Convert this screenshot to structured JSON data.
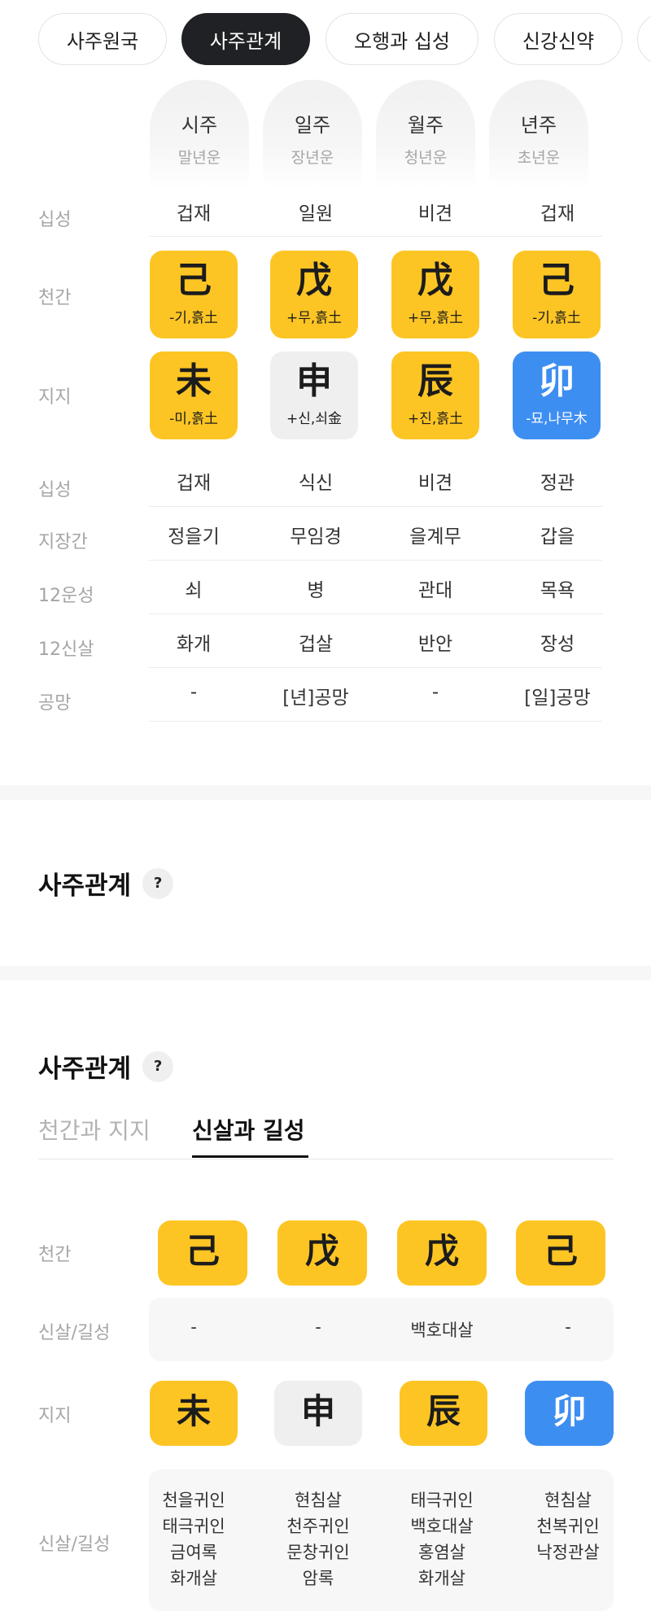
{
  "tabs": [
    {
      "label": "사주원국",
      "active": false
    },
    {
      "label": "사주관계",
      "active": true
    },
    {
      "label": "오행과 십성",
      "active": false
    },
    {
      "label": "신강신약",
      "active": false
    }
  ],
  "pillars": {
    "columns": [
      {
        "title": "시주",
        "subtitle": "말년운"
      },
      {
        "title": "일주",
        "subtitle": "장년운"
      },
      {
        "title": "월주",
        "subtitle": "청년운"
      },
      {
        "title": "년주",
        "subtitle": "초년운"
      }
    ],
    "labels": {
      "sipseong_top": "십성",
      "cheongan": "천간",
      "jiji": "지지",
      "sipseong_bottom": "십성",
      "jijanggan": "지장간",
      "unseong": "12운성",
      "sinsal": "12신살",
      "gongmang": "공망"
    },
    "sipseong_top": [
      "겁재",
      "일원",
      "비견",
      "겁재"
    ],
    "cheongan": [
      {
        "char": "己",
        "sub": "-기,흙土",
        "color": "yellow"
      },
      {
        "char": "戊",
        "sub": "+무,흙土",
        "color": "yellow"
      },
      {
        "char": "戊",
        "sub": "+무,흙土",
        "color": "yellow"
      },
      {
        "char": "己",
        "sub": "-기,흙土",
        "color": "yellow"
      }
    ],
    "jiji": [
      {
        "char": "未",
        "sub": "-미,흙土",
        "color": "yellow"
      },
      {
        "char": "申",
        "sub": "+신,쇠金",
        "color": "gray"
      },
      {
        "char": "辰",
        "sub": "+진,흙土",
        "color": "yellow"
      },
      {
        "char": "卯",
        "sub": "-묘,나무木",
        "color": "blue"
      }
    ],
    "sipseong_bottom": [
      "겁재",
      "식신",
      "비견",
      "정관"
    ],
    "jijanggan": [
      "정을기",
      "무임경",
      "을계무",
      "갑을"
    ],
    "unseong": [
      "쇠",
      "병",
      "관대",
      "목욕"
    ],
    "sinsal": [
      "화개",
      "겁살",
      "반안",
      "장성"
    ],
    "gongmang": [
      "-",
      "[년]공망",
      "-",
      "[일]공망"
    ]
  },
  "section1": {
    "title": "사주관계",
    "help": "?"
  },
  "section2": {
    "title": "사주관계",
    "help": "?"
  },
  "subtabs": [
    {
      "label": "천간과 지지",
      "active": false
    },
    {
      "label": "신살과 길성",
      "active": true
    }
  ],
  "relations": {
    "labels": {
      "cheongan": "천간",
      "sinsal_top": "신살/길성",
      "jiji": "지지",
      "sinsal_bottom": "신살/길성"
    },
    "cheongan": [
      {
        "char": "己",
        "color": "yellow"
      },
      {
        "char": "戊",
        "color": "yellow"
      },
      {
        "char": "戊",
        "color": "yellow"
      },
      {
        "char": "己",
        "color": "yellow"
      }
    ],
    "sinsal_top": [
      "-",
      "-",
      "백호대살",
      "-"
    ],
    "jiji": [
      {
        "char": "未",
        "color": "yellow"
      },
      {
        "char": "申",
        "color": "gray"
      },
      {
        "char": "辰",
        "color": "yellow"
      },
      {
        "char": "卯",
        "color": "blue"
      }
    ],
    "sinsal_bottom": [
      [
        "천을귀인",
        "태극귀인",
        "금여록",
        "화개살"
      ],
      [
        "현침살",
        "천주귀인",
        "문창귀인",
        "암록"
      ],
      [
        "태극귀인",
        "백호대살",
        "홍염살",
        "화개살"
      ],
      [
        "현침살",
        "천복귀인",
        "낙정관살"
      ]
    ]
  },
  "colors": {
    "yellow": "#fdc524",
    "gray": "#efefef",
    "blue": "#3d8ef1",
    "dark": "#1f2124"
  }
}
